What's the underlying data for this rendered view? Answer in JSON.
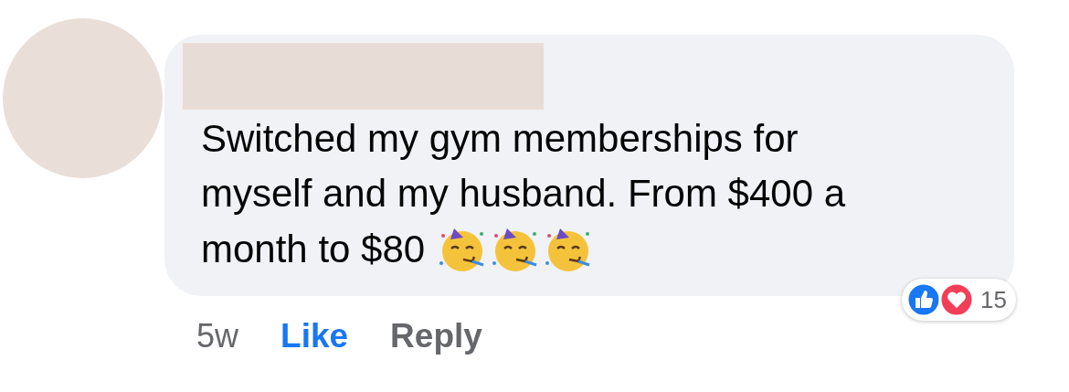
{
  "comment": {
    "lines": [
      "Switched my gym memberships for",
      "myself and my husband. From $400 a",
      "month to $80"
    ],
    "emojis": [
      {
        "kind": "party"
      },
      {
        "kind": "party"
      },
      {
        "kind": "party"
      }
    ],
    "time": "5w",
    "actions": [
      {
        "label": "Like",
        "selected": true
      },
      {
        "label": "Reply",
        "selected": false
      }
    ],
    "reactions": [
      {
        "kind": "like"
      },
      {
        "kind": "love"
      }
    ],
    "reaction_count": "15"
  }
}
